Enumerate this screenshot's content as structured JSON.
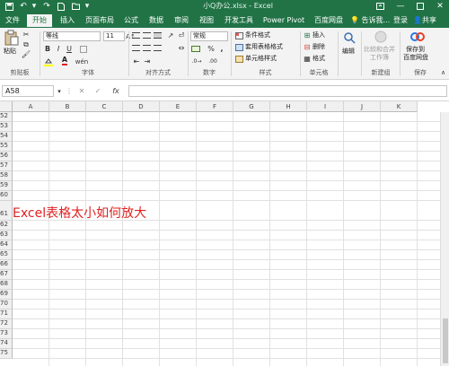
{
  "window": {
    "title": "小Q办公.xlsx - Excel"
  },
  "qat": {
    "save_icon": "save-icon",
    "undo_icon": "undo-icon",
    "redo_icon": "redo-icon"
  },
  "menu": {
    "tabs": [
      "文件",
      "开始",
      "插入",
      "页面布局",
      "公式",
      "数据",
      "审阅",
      "视图",
      "开发工具",
      "Power Pivot",
      "百度网盘"
    ],
    "active_index": 1,
    "tell_me": "告诉我...",
    "login": "登录",
    "share": "共享"
  },
  "ribbon": {
    "clipboard": {
      "paste": "粘贴",
      "label": "剪贴板"
    },
    "font": {
      "name": "等线",
      "size": "11",
      "label": "字体",
      "bold": "B",
      "italic": "I",
      "underline": "U",
      "font_color_glyph": "A"
    },
    "align": {
      "label": "对齐方式"
    },
    "number": {
      "format": "常规",
      "label": "数字",
      "percent": "%",
      "comma": ","
    },
    "styles": {
      "cond_format": "条件格式",
      "table_format": "套用表格格式",
      "cell_styles": "单元格样式",
      "label": "样式"
    },
    "cells": {
      "insert": "插入",
      "delete": "删除",
      "format": "格式",
      "label": "单元格"
    },
    "editing": {
      "edit": "编辑"
    },
    "compare": {
      "line1": "比较和合并",
      "line2": "工作簿",
      "label": "新建组"
    },
    "baidu": {
      "line1": "保存到",
      "line2": "百度网盘",
      "label": "保存"
    }
  },
  "formula_bar": {
    "name_box": "A58",
    "fx": "fx",
    "cancel": "✕",
    "enter": "✓",
    "value": ""
  },
  "grid": {
    "columns": [
      "A",
      "B",
      "C",
      "D",
      "E",
      "F",
      "G",
      "H",
      "I",
      "J",
      "K"
    ],
    "rows": [
      "52",
      "53",
      "54",
      "55",
      "56",
      "57",
      "58",
      "59",
      "60",
      "61",
      "62",
      "63",
      "64",
      "65",
      "66",
      "67",
      "68",
      "69",
      "70",
      "71",
      "72",
      "73",
      "74",
      "75"
    ],
    "cell_text": "Excel表格太小如何放大"
  }
}
